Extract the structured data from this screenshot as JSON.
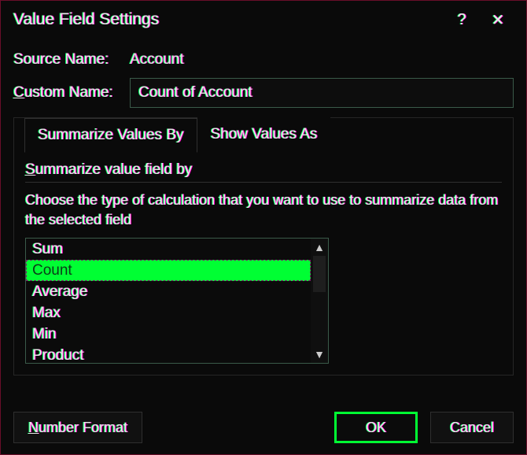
{
  "title": "Value Field Settings",
  "help_glyph": "?",
  "close_glyph": "✕",
  "source_name_label": "Source Name:",
  "source_name_value": "Account",
  "custom_name_label_pre": "",
  "custom_name_label_u": "C",
  "custom_name_label_post": "ustom Name:",
  "custom_name_value": "Count of Account",
  "tabs": {
    "summarize": "Summarize Values By",
    "showas": "Show Values As"
  },
  "section_head_pre": "",
  "section_head_u": "S",
  "section_head_post": "ummarize value field by",
  "description": "Choose the type of calculation that you want to use to summarize data from the selected field",
  "list": [
    "Sum",
    "Count",
    "Average",
    "Max",
    "Min",
    "Product"
  ],
  "selected_index": 1,
  "buttons": {
    "number_format_pre": "",
    "number_format_u": "N",
    "number_format_post": "umber Format",
    "ok": "OK",
    "cancel": "Cancel"
  },
  "scroll": {
    "up": "▲",
    "down": "▼"
  }
}
